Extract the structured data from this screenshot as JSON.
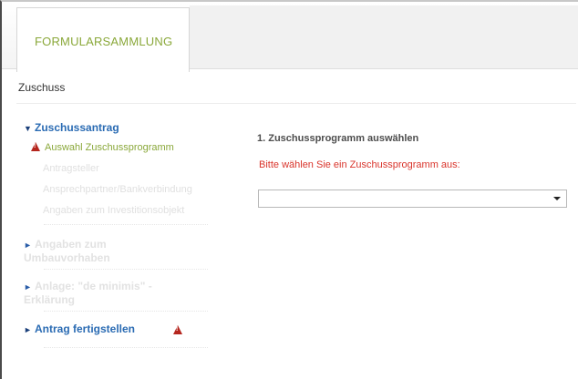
{
  "header": {
    "tab_label": "FORMULARSAMMLUNG"
  },
  "page": {
    "title": "Zuschuss"
  },
  "sidebar": {
    "sections": [
      {
        "label": "Zuschussantrag",
        "expanded": true
      },
      {
        "label": "Angaben zum Umbauvorhaben",
        "expanded": false
      },
      {
        "label": "Anlage: \"de minimis\" - Erklärung",
        "expanded": false
      },
      {
        "label": "Antrag fertigstellen",
        "expanded": false,
        "warning": true
      }
    ],
    "items": [
      {
        "label": "Auswahl Zuschussprogramm",
        "active": true,
        "warning": true
      },
      {
        "label": "Antragsteller"
      },
      {
        "label": "Ansprechpartner/Bankverbindung"
      },
      {
        "label": "Angaben zum Investitionsobjekt"
      }
    ]
  },
  "main": {
    "step_title": "1. Zuschussprogramm auswählen",
    "hint": "Bitte wählen Sie ein Zuschussprogramm aus:",
    "select": {
      "value": ""
    }
  },
  "colors": {
    "accent_green": "#8aa83a",
    "link_blue": "#2a6bb3",
    "error_red": "#d9342b",
    "warning_red": "#b5261e"
  }
}
